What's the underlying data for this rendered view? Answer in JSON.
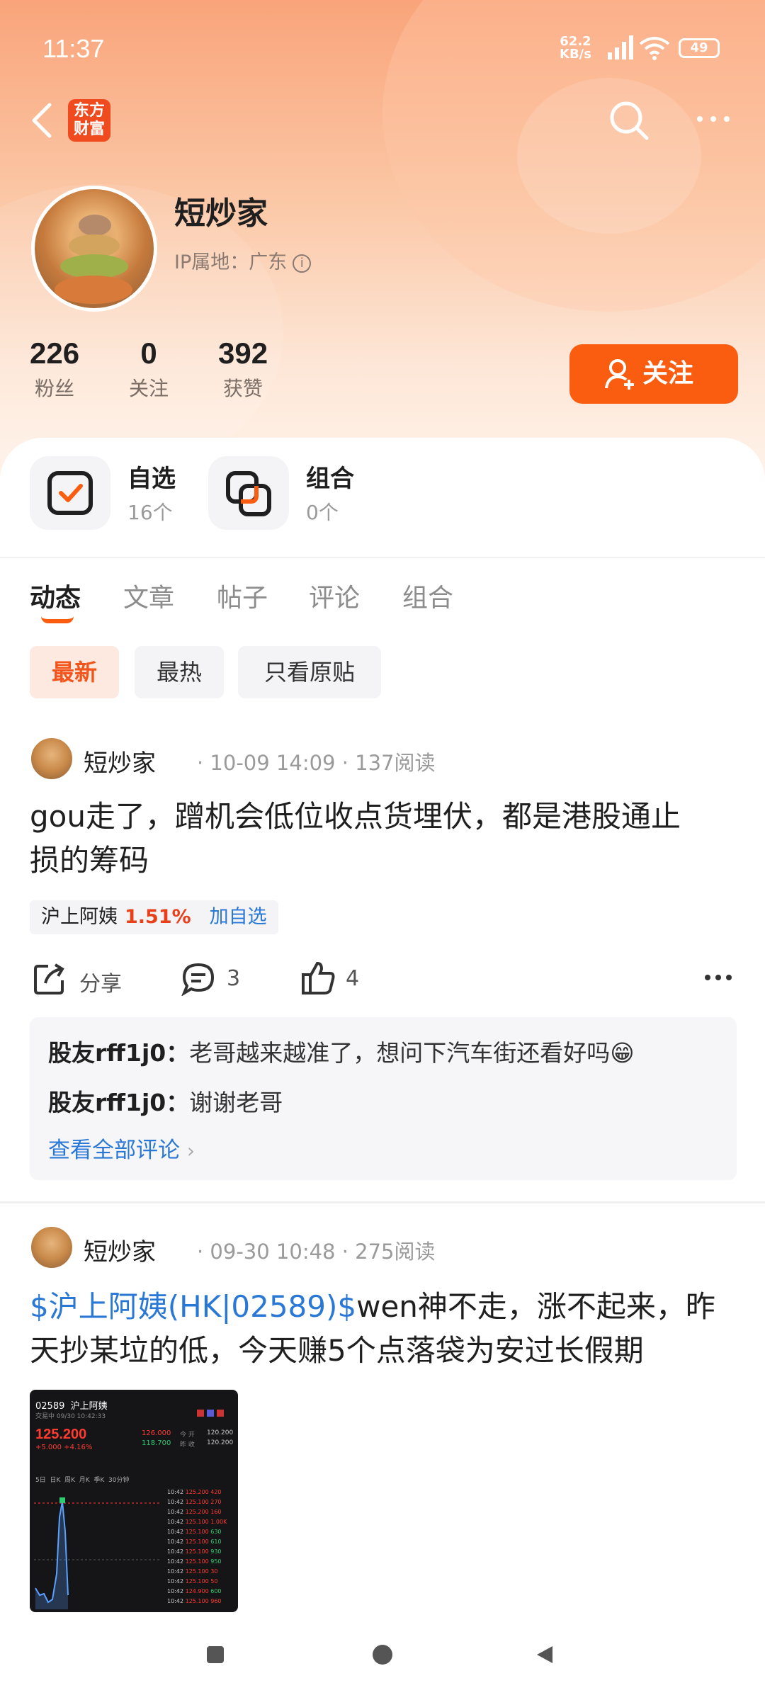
{
  "status_bar": {
    "time": "11:37",
    "net_speed_value": "62.2",
    "net_speed_unit": "KB/s",
    "battery": "49"
  },
  "app": {
    "logo_line1": "东方",
    "logo_line2": "财富"
  },
  "profile": {
    "name": "短炒家",
    "ip_label": "IP属地：广东"
  },
  "stats": [
    {
      "value": "226",
      "label": "粉丝"
    },
    {
      "value": "0",
      "label": "关注"
    },
    {
      "value": "392",
      "label": "获赞"
    }
  ],
  "follow_button": "关注",
  "shortcuts": {
    "watchlist": {
      "title": "自选",
      "count": "16个"
    },
    "portfolio": {
      "title": "组合",
      "count": "0个"
    }
  },
  "tabs": [
    "动态",
    "文章",
    "帖子",
    "评论",
    "组合"
  ],
  "filters": [
    "最新",
    "最热",
    "只看原贴"
  ],
  "posts": [
    {
      "author": "短炒家",
      "meta": "· 10-09 14:09 · 137阅读",
      "text_line1": "gou走了，蹭机会低位收点货埋伏，都是港股通止",
      "text_line2": "损的筹码",
      "tag": {
        "name": "沪上阿姨",
        "change": "1.51%",
        "add": "加自选"
      },
      "actions": {
        "share": "分享",
        "comments": "3",
        "likes": "4"
      },
      "comments": [
        {
          "user": "股友rff1j0：",
          "text": "老哥越来越准了，想问下汽车街还看好吗😁"
        },
        {
          "user": "股友rff1j0：",
          "text": "谢谢老哥"
        }
      ],
      "view_all": "查看全部评论"
    },
    {
      "author": "短炒家",
      "meta": "· 09-30 10:48 · 275阅读",
      "stock_link": "$沪上阿姨(HK|02589)$",
      "text_line1_rest": "wen神不走，涨不起来，昨",
      "text_line2": "天抄某垃的低，今天赚5个点落袋为安过长假期",
      "thumbnail": {
        "code": "02589",
        "name": "沪上阿姨",
        "time": "交易中 09/30 10:42:33",
        "price": "125.200",
        "change": "+5.000 +4.16%",
        "open_label": "今 开",
        "open": "120.200",
        "prev_label": "昨 收",
        "prev": "120.200",
        "high": "126.000",
        "low": "118.700",
        "periods": [
          "5日",
          "日K",
          "周K",
          "月K",
          "季K",
          "30分钟"
        ],
        "ticks": [
          {
            "time": "10:42",
            "price": "125.200",
            "vol": "420"
          },
          {
            "time": "10:42",
            "price": "125.100",
            "vol": "270"
          },
          {
            "time": "10:42",
            "price": "125.200",
            "vol": "160"
          },
          {
            "time": "10:42",
            "price": "125.100",
            "vol": "1.00K"
          },
          {
            "time": "10:42",
            "price": "125.100",
            "vol": "630"
          },
          {
            "time": "10:42",
            "price": "125.100",
            "vol": "610"
          },
          {
            "time": "10:42",
            "price": "125.100",
            "vol": "930"
          },
          {
            "time": "10:42",
            "price": "125.100",
            "vol": "950"
          },
          {
            "time": "10:42",
            "price": "125.100",
            "vol": "30"
          },
          {
            "time": "10:42",
            "price": "125.100",
            "vol": "50"
          },
          {
            "time": "10:42",
            "price": "124.900",
            "vol": "600"
          },
          {
            "time": "10:42",
            "price": "125.100",
            "vol": "960"
          }
        ]
      }
    }
  ],
  "colors": {
    "accent": "#fa5d10",
    "link": "#2a78d6",
    "up": "#e8401a"
  }
}
